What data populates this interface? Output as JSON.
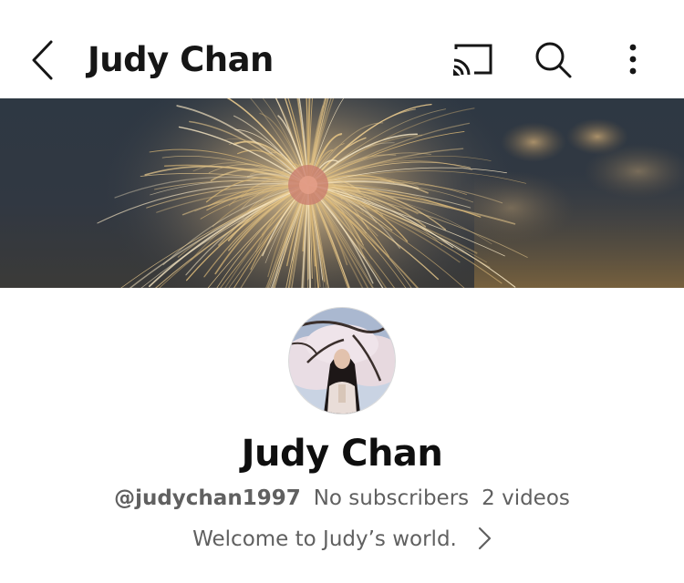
{
  "appbar": {
    "title": "Judy Chan",
    "icons": [
      "back-icon",
      "cast-icon",
      "search-icon",
      "more-vert-icon"
    ]
  },
  "banner": {
    "description_icon": "fireworks-banner-image"
  },
  "channel": {
    "name": "Judy Chan",
    "handle": "@judychan1997",
    "subscribers": "No subscribers",
    "videos": "2 videos",
    "description": "Welcome to Judy’s world."
  },
  "colors": {
    "text_primary": "#0f0f0f",
    "text_secondary": "#606060",
    "background": "#ffffff"
  }
}
